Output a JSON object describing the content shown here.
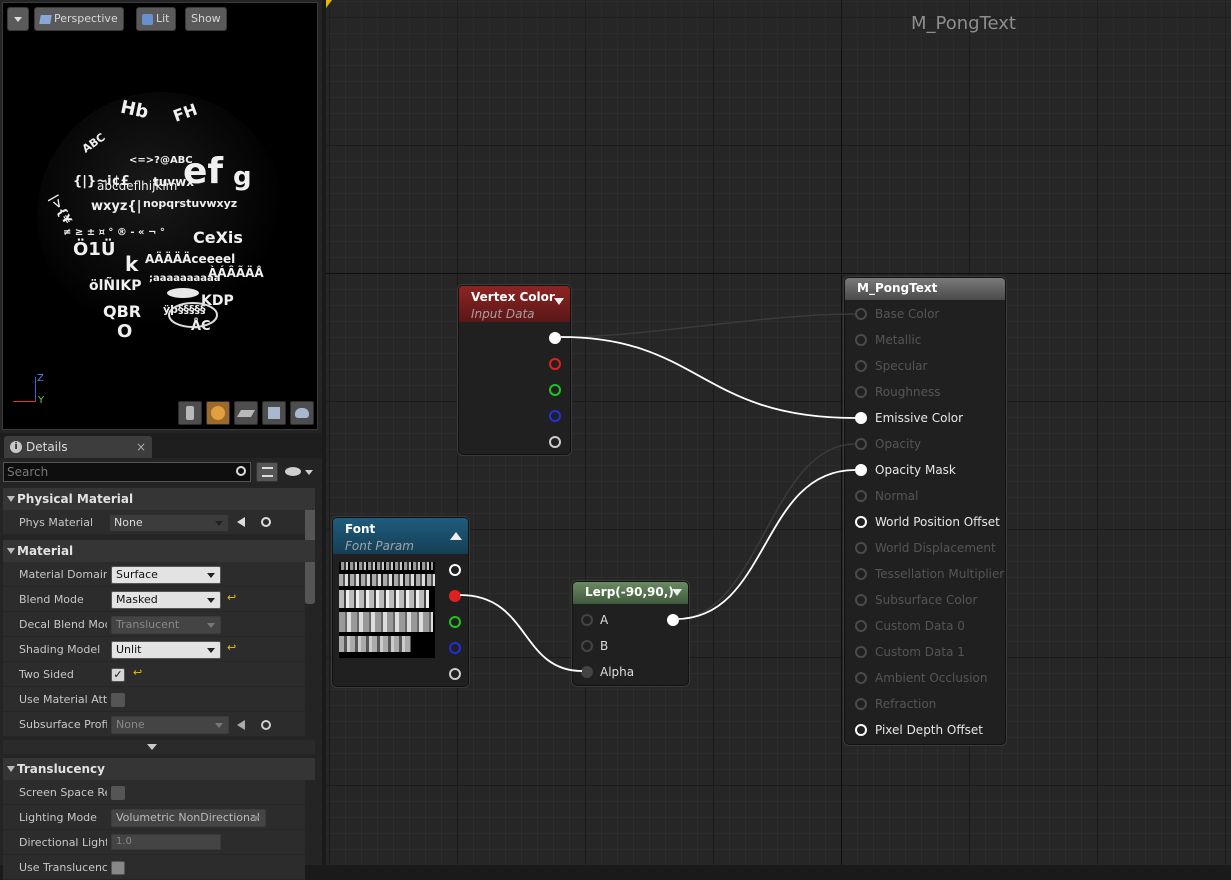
{
  "viewport": {
    "menu_icon": "dropdown-arrow-icon",
    "perspective_label": "Perspective",
    "lit_label": "Lit",
    "show_label": "Show",
    "axis_z": "Z",
    "axis_y": "Y",
    "preview_buttons": [
      "cylinder-icon",
      "sphere-icon",
      "plane-icon",
      "cube-icon",
      "teapot-icon"
    ]
  },
  "details": {
    "tab_label": "Details",
    "tab_close": "×",
    "search_placeholder": "Search",
    "categories": {
      "physical_material": "Physical Material",
      "material": "Material",
      "translucency": "Translucency"
    },
    "properties": {
      "phys_material": {
        "label": "Phys Material",
        "value": "None"
      },
      "material_domain": {
        "label": "Material Domain",
        "value": "Surface"
      },
      "blend_mode": {
        "label": "Blend Mode",
        "value": "Masked"
      },
      "decal_blend_mode": {
        "label": "Decal Blend Mode",
        "value": "Translucent"
      },
      "shading_model": {
        "label": "Shading Model",
        "value": "Unlit"
      },
      "two_sided": {
        "label": "Two Sided",
        "value": "✓"
      },
      "use_material_attributes": {
        "label": "Use Material Attributes"
      },
      "subsurface_profile": {
        "label": "Subsurface Profile",
        "value": "None"
      },
      "screen_space_reflections": {
        "label": "Screen Space Reflections"
      },
      "lighting_mode": {
        "label": "Lighting Mode",
        "value": "Volumetric NonDirectional"
      },
      "directional_lighting": {
        "label": "Directional Lighting Intensity",
        "value": "1.0"
      },
      "use_translucency": {
        "label": "Use Translucency Vertex Fog"
      }
    }
  },
  "graph": {
    "title": "M_PongText",
    "nodes": {
      "vertex_color": {
        "title": "Vertex Color",
        "subtitle": "Input Data"
      },
      "font": {
        "title": "Font",
        "subtitle": "Font Param"
      },
      "lerp": {
        "title": "Lerp(-90,90,)",
        "inputs": [
          "A",
          "B",
          "Alpha"
        ]
      },
      "result": {
        "title": "M_PongText",
        "inputs": [
          "Base Color",
          "Metallic",
          "Specular",
          "Roughness",
          "Emissive Color",
          "Opacity",
          "Opacity Mask",
          "Normal",
          "World Position Offset",
          "World Displacement",
          "Tessellation Multiplier",
          "Subsurface Color",
          "Custom Data 0",
          "Custom Data 1",
          "Ambient Occlusion",
          "Refraction",
          "Pixel Depth Offset"
        ],
        "active_inputs": [
          4,
          6,
          8,
          16
        ]
      }
    }
  },
  "colors": {
    "vertex_header": "#8b1c1c",
    "font_header": "#1d5a7a",
    "lerp_header": "#5c7a55",
    "result_header": "#6a6a6a",
    "pin_red": "#e02020",
    "pin_green": "#1fc41f",
    "pin_blue": "#2030e0"
  }
}
